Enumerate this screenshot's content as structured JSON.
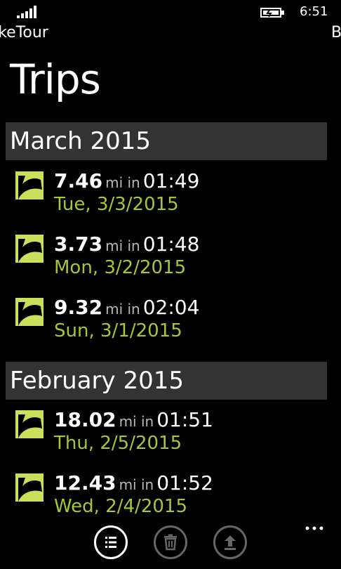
{
  "status_bar": {
    "time": "6:51",
    "signal_icon": "signal-strength-icon",
    "battery_icon": "battery-charging-icon"
  },
  "pivot": {
    "current": "BikeTour",
    "next": "B"
  },
  "page_title": "Trips",
  "groups": [
    {
      "header": "March 2015",
      "trips": [
        {
          "distance": "7.46",
          "unit": "mi in",
          "duration": "01:49",
          "date": "Tue, 3/3/2015"
        },
        {
          "distance": "3.73",
          "unit": "mi in",
          "duration": "01:48",
          "date": "Mon, 3/2/2015"
        },
        {
          "distance": "9.32",
          "unit": "mi in",
          "duration": "02:04",
          "date": "Sun, 3/1/2015"
        }
      ]
    },
    {
      "header": "February 2015",
      "trips": [
        {
          "distance": "18.02",
          "unit": "mi in",
          "duration": "01:51",
          "date": "Thu, 2/5/2015"
        },
        {
          "distance": "12.43",
          "unit": "mi in",
          "duration": "01:52",
          "date": "Wed, 2/4/2015"
        }
      ]
    }
  ],
  "app_bar": {
    "buttons": [
      "list-icon",
      "delete-icon",
      "upload-icon"
    ],
    "more_icon": "more-ellipsis-icon"
  },
  "colors": {
    "accent": "#a4c639",
    "background": "#000000",
    "group_header_bg": "#333333"
  }
}
